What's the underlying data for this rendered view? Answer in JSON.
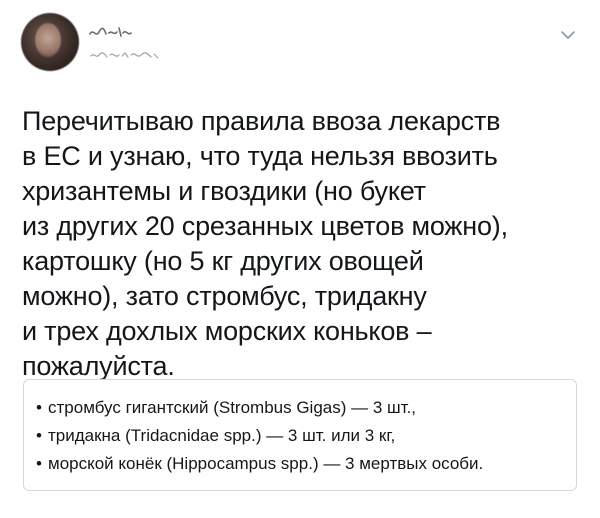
{
  "tweet": {
    "text": "Перечитываю правила ввоза лекарств\nв ЕС и узнаю, что туда нельзя ввозить\nхризантемы и гвоздики (но букет\nиз других 20 срезанных цветов можно),\nкартошку (но 5 кг других овощей\nможно), зато стромбус, тридакну\nи трех дохлых морских коньков –\nпожалуйста.",
    "quote": {
      "bullet": "•",
      "items": [
        "стромбус гигантский (Strombus Gigas) — 3 шт.,",
        "тридакна (Tridacnidae spp.) — 3 шт. или 3 кг,",
        "морской конёк (Hippocampus spp.) — 3 мертвых особи."
      ]
    }
  },
  "icons": {
    "avatar": "avatar",
    "menu": "chevron-down-icon"
  },
  "colors": {
    "text": "#14171a",
    "border": "#cfd9de",
    "icon": "#8899a6"
  }
}
